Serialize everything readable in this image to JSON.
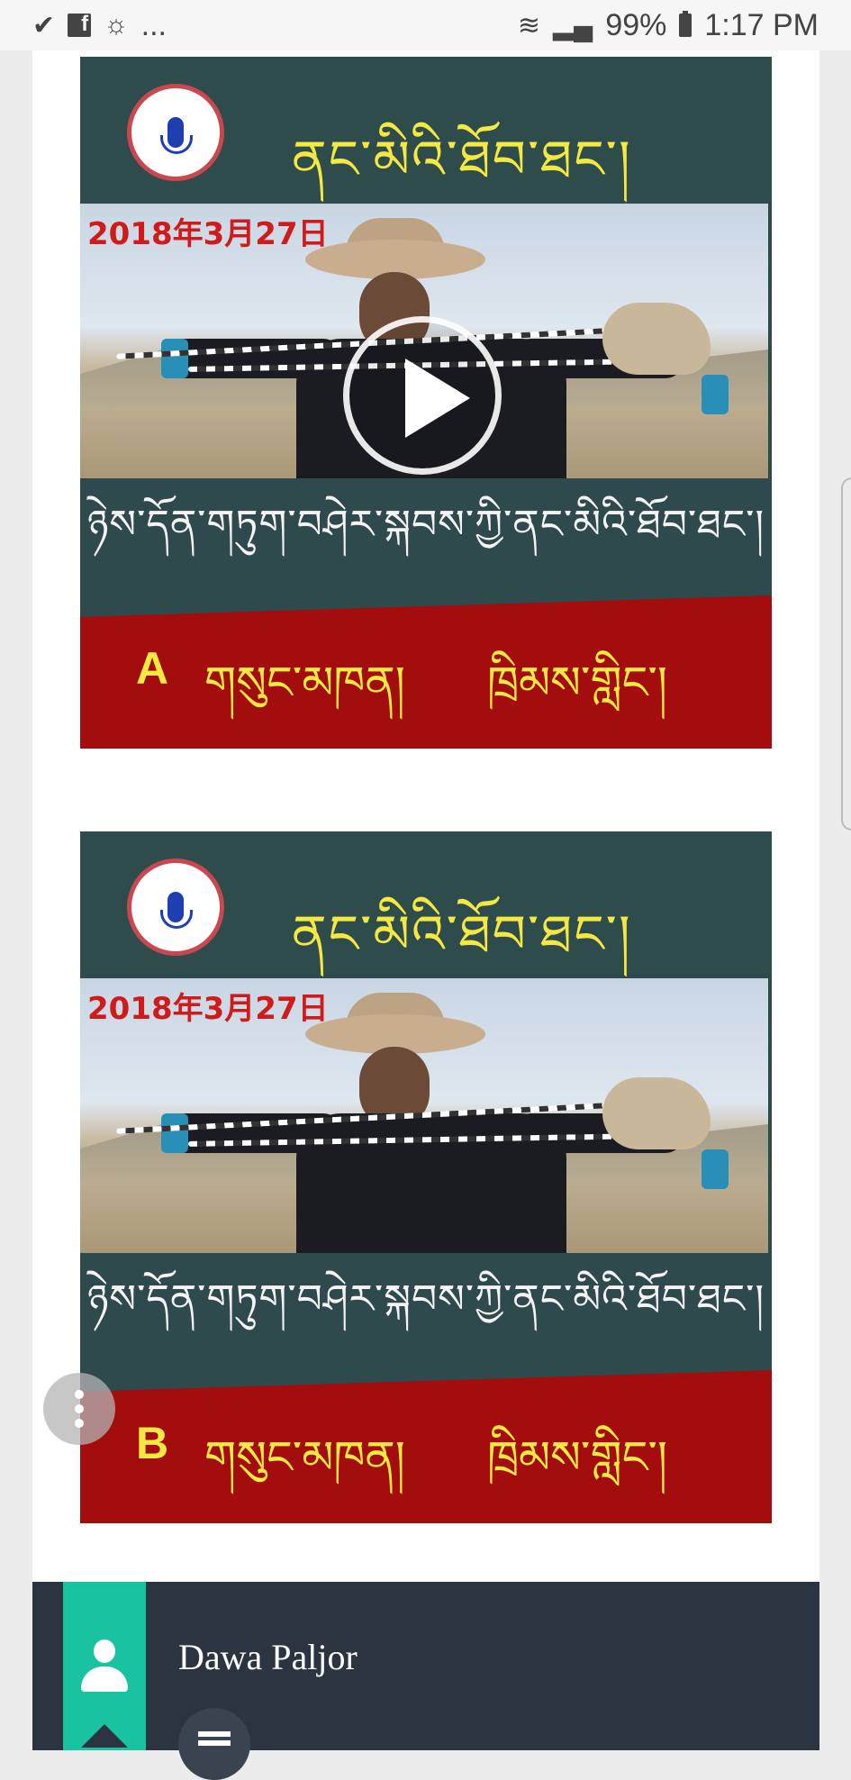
{
  "statusbar": {
    "left_icons": [
      "email-check-icon",
      "facebook-icon",
      "weather-icon"
    ],
    "more": "...",
    "battery": "99%",
    "time": "1:17 PM"
  },
  "videos": [
    {
      "title": "ནང་མིའི་ཐོབ་ཐང་།",
      "date": "2018年3月27日",
      "banner": "ཉེས་དོན་གཏུག་བཤེར་སྐབས་ཀྱི་ནང་མིའི་ཐོབ་ཐང་།",
      "part_letter": "A",
      "part_text_1": "གསུང་མཁན།",
      "part_text_2": "ཁྲིམས་གླིང་།",
      "has_play_button": true
    },
    {
      "title": "ནང་མིའི་ཐོབ་ཐང་།",
      "date": "2018年3月27日",
      "banner": "ཉེས་དོན་གཏུག་བཤེར་སྐབས་ཀྱི་ནང་མིའི་ཐོབ་ཐང་།",
      "part_letter": "B",
      "part_text_1": "གསུང་མཁན།",
      "part_text_2": "ཁྲིམས་གླིང་།",
      "has_play_button": false
    }
  ],
  "footer": {
    "author": "Dawa Paljor"
  },
  "colors": {
    "header_green": "#2f4c4d",
    "title_yellow": "#f4e842",
    "band_red": "#a30d0d",
    "footer_dark": "#2b3440",
    "teal": "#19c2a1"
  }
}
